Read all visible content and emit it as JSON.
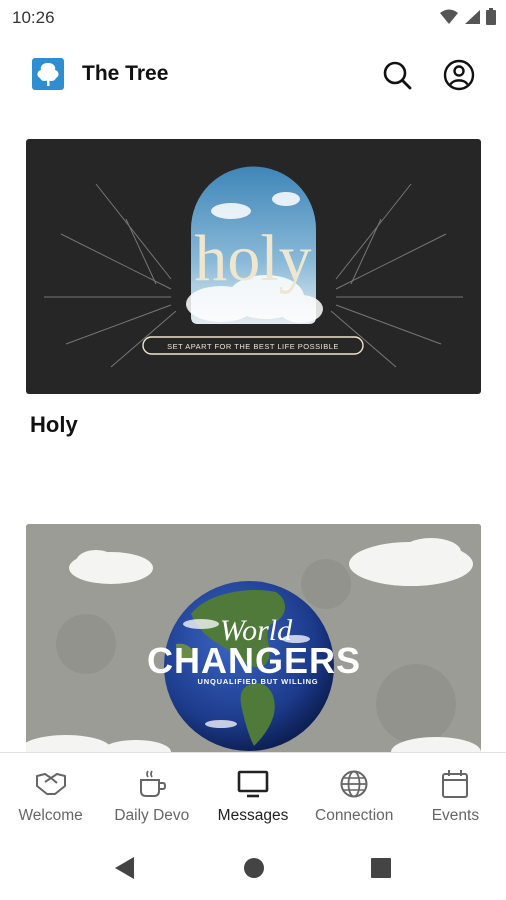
{
  "status_bar": {
    "time": "10:26",
    "icons": [
      "wifi-icon",
      "signal-icon",
      "battery-icon"
    ]
  },
  "app_bar": {
    "title": "The Tree",
    "logo_icon": "tree-logo-icon",
    "actions": [
      "search-icon",
      "account-icon"
    ]
  },
  "feed": {
    "cards": [
      {
        "title": "Holy",
        "artwork": {
          "headline": "holy",
          "tagline": "SET APART FOR THE BEST LIFE POSSIBLE"
        }
      },
      {
        "title": "",
        "artwork": {
          "headline_top": "World",
          "headline": "CHANGERS",
          "tagline": "UNQUALIFIED BUT WILLING"
        }
      }
    ]
  },
  "bottom_nav": {
    "items": [
      {
        "label": "Welcome",
        "icon": "handshake-icon",
        "active": false
      },
      {
        "label": "Daily Devo",
        "icon": "coffee-cup-icon",
        "active": false
      },
      {
        "label": "Messages",
        "icon": "tv-icon",
        "active": true
      },
      {
        "label": "Connection",
        "icon": "globe-icon",
        "active": false
      },
      {
        "label": "Events",
        "icon": "calendar-icon",
        "active": false
      }
    ]
  },
  "colors": {
    "active_nav": "#222222",
    "inactive_nav": "#666666",
    "holy_bg": "#262626",
    "holy_cream": "#efe6cf"
  }
}
